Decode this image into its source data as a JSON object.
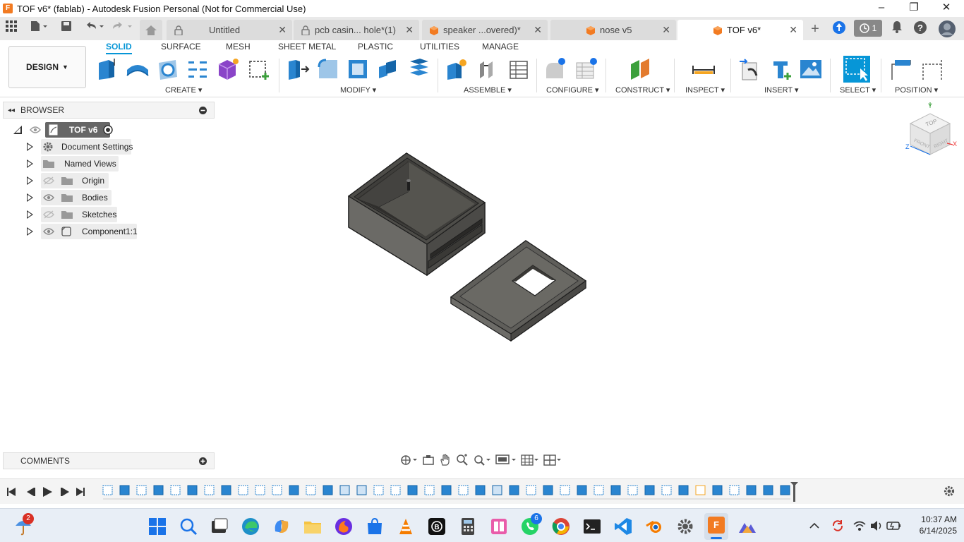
{
  "window": {
    "title": "TOF v6* (fablab) - Autodesk Fusion Personal (Not for Commercial Use)",
    "minimize": "–",
    "maximize": "❐",
    "close": "✕"
  },
  "tabs": [
    {
      "label": "Untitled",
      "icon": "lock-icon",
      "active": false
    },
    {
      "label": "pcb casin... hole*(1)",
      "icon": "lock-icon",
      "active": false
    },
    {
      "label": "speaker ...overed)*",
      "icon": "component-icon",
      "active": false
    },
    {
      "label": "nose v5",
      "icon": "component-icon",
      "active": false
    },
    {
      "label": "TOF v6*",
      "icon": "component-icon",
      "active": true
    }
  ],
  "tab_close": "✕",
  "header_right": {
    "new_tab": "+",
    "job_count": "1"
  },
  "workspace": {
    "mode_label": "DESIGN",
    "tabs": [
      "SOLID",
      "SURFACE",
      "MESH",
      "SHEET METAL",
      "PLASTIC",
      "UTILITIES",
      "MANAGE"
    ],
    "active_tab": "SOLID",
    "groups": [
      "CREATE",
      "MODIFY",
      "ASSEMBLE",
      "CONFIGURE",
      "CONSTRUCT",
      "INSPECT",
      "INSERT",
      "SELECT",
      "POSITION"
    ]
  },
  "browser": {
    "title": "BROWSER",
    "root": "TOF v6",
    "items": [
      {
        "label": "Document Settings",
        "icon": "gear-icon",
        "eye": false
      },
      {
        "label": "Named Views",
        "icon": "folder-icon",
        "eye": false
      },
      {
        "label": "Origin",
        "icon": "folder-icon",
        "eye": "hidden"
      },
      {
        "label": "Bodies",
        "icon": "folder-icon",
        "eye": "visible"
      },
      {
        "label": "Sketches",
        "icon": "folder-icon",
        "eye": "hidden"
      },
      {
        "label": "Component1:1",
        "icon": "component-icon",
        "eye": "visible"
      }
    ]
  },
  "comments": {
    "title": "COMMENTS"
  },
  "viewcube": {
    "top": "TOP",
    "front": "FRONT",
    "right": "RIGHT",
    "x": "X",
    "y": "Y",
    "z": "Z"
  },
  "taskbar": {
    "weather_badge": "2",
    "whatsapp_badge": "6",
    "time": "10:37 AM",
    "date": "6/14/2025"
  },
  "colors": {
    "accent": "#0696d7",
    "fusion_orange": "#f27b22",
    "model_gray": "#5a5955"
  }
}
